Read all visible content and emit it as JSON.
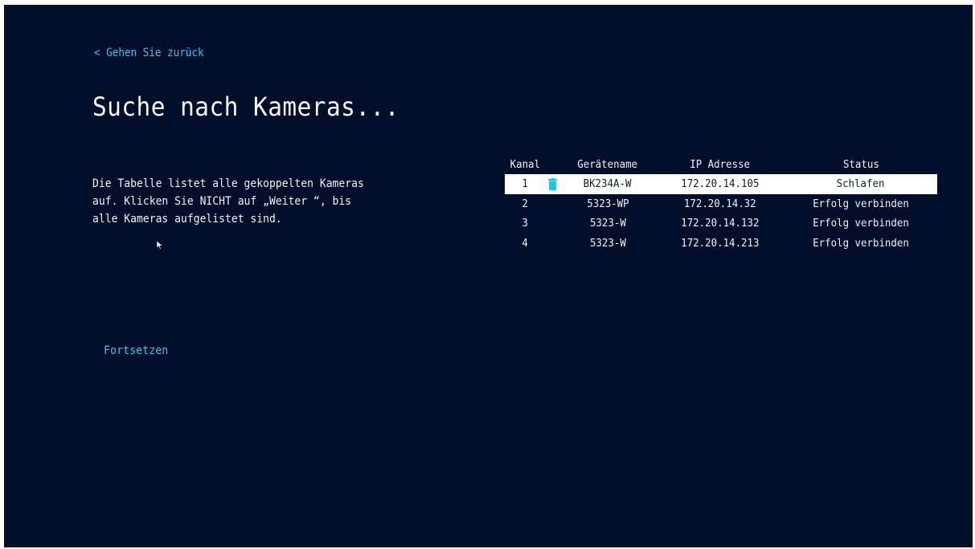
{
  "back_link": "< Gehen Sie zurück",
  "title": "Suche nach Kameras...",
  "description": [
    "Die Tabelle listet alle gekoppelten Kameras",
    "auf. Klicken Sie NICHT auf „Weiter “, bis",
    "alle Kameras aufgelistet sind."
  ],
  "continue_label": "Fortsetzen",
  "table": {
    "headers": {
      "kanal": "Kanal",
      "name": "Gerätename",
      "ip": "IP Adresse",
      "status": "Status"
    },
    "rows": [
      {
        "kanal": "1",
        "name": "BK234A-W",
        "ip": "172.20.14.105",
        "status": "Schlafen",
        "selected": true,
        "has_delete_icon": true
      },
      {
        "kanal": "2",
        "name": "5323-WP",
        "ip": "172.20.14.32",
        "status": "Erfolg verbinden"
      },
      {
        "kanal": "3",
        "name": "5323-W",
        "ip": "172.20.14.132",
        "status": "Erfolg verbinden"
      },
      {
        "kanal": "4",
        "name": "5323-W",
        "ip": "172.20.14.213",
        "status": "Erfolg verbinden"
      }
    ]
  },
  "icons": {
    "delete": "trash-icon",
    "pointer": "mouse-pointer-icon"
  },
  "colors": {
    "background": "#020f2a",
    "accent": "#39c3f2",
    "text": "#f2f4f8",
    "selected_row": "#ffffff",
    "trash_icon": "#12c8f0"
  }
}
